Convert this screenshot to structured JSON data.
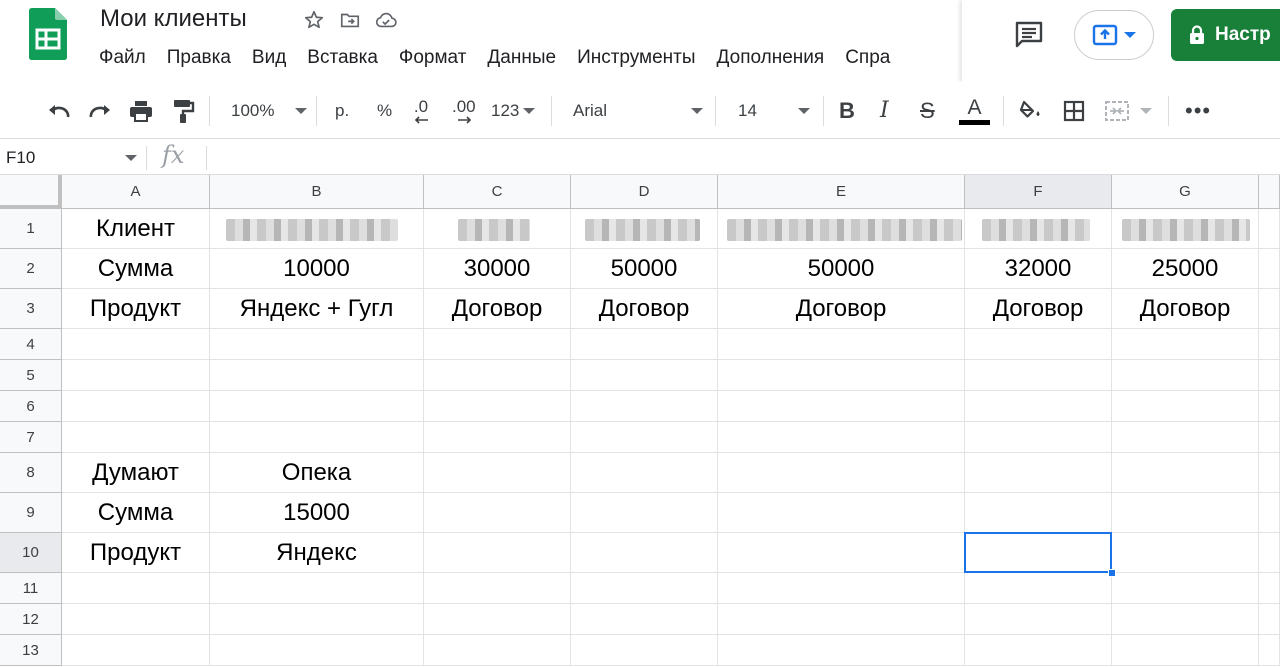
{
  "doc": {
    "title": "Мои клиенты"
  },
  "menu": [
    "Файл",
    "Правка",
    "Вид",
    "Вставка",
    "Формат",
    "Данные",
    "Инструменты",
    "Дополнения",
    "Спра"
  ],
  "share": {
    "label": "Настр"
  },
  "toolbar": {
    "zoom": "100%",
    "currency": "р.",
    "percent": "%",
    "dec_decrease": ".0",
    "dec_increase": ".00",
    "format_more": "123",
    "font": "Arial",
    "font_size": "14"
  },
  "formula": {
    "cell_ref": "F10",
    "fx": "fx"
  },
  "sheet": {
    "columns": [
      "A",
      "B",
      "C",
      "D",
      "E",
      "F",
      "G"
    ],
    "rows": [
      "1",
      "2",
      "3",
      "4",
      "5",
      "6",
      "7",
      "8",
      "9",
      "10",
      "11",
      "12",
      "13"
    ],
    "selected_cell": "F10",
    "cells": {
      "A1": "Клиент",
      "A2": "Сумма",
      "B2": "10000",
      "C2": "30000",
      "D2": "50000",
      "E2": "50000",
      "F2": "32000",
      "G2": "25000",
      "A3": "Продукт",
      "B3": "Яндекс + Гугл",
      "C3": "Договор",
      "D3": "Договор",
      "E3": "Договор",
      "F3": "Договор",
      "G3": "Договор",
      "A8": "Думают",
      "B8": "Опека",
      "A9": "Сумма",
      "B9": "15000",
      "A10": "Продукт",
      "B10": "Яндекс"
    }
  },
  "colors": {
    "accent": "#1a73e8",
    "share_bg": "#188038",
    "logo": "#0f9d58"
  },
  "icons": {
    "logo": "sheets-logo-icon",
    "star": "star-icon",
    "move": "move-to-folder-icon",
    "cloud": "cloud-status-icon",
    "comment": "comment-icon",
    "present": "present-icon",
    "lock": "lock-icon"
  }
}
